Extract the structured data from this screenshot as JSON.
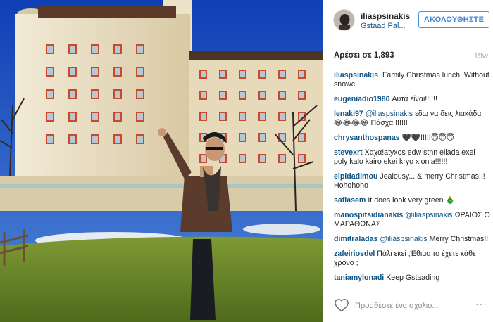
{
  "header": {
    "username": "iliaspsinakis",
    "location": "Gstaad Pal...",
    "follow_label": "ΑΚΟΛΟΥΘΗΣΤΕ"
  },
  "stats": {
    "likes_label": "Αρέσει σε 1,893",
    "time_ago": "19w"
  },
  "comments": [
    {
      "user": "iliaspsinakis",
      "text": " Family Christmas lunch  Without snowc"
    },
    {
      "user": "eugeniadio1980",
      "text": "Αυτά είναι!!!!!!"
    },
    {
      "user": "lenaki97",
      "mention": "@iliaspsinakis",
      "text": "εδω να δεις λιακάδα 😂😂😂😂 Πάσχα !!!!!!"
    },
    {
      "user": "chrysanthospanas",
      "text": "🖤🖤!!!!!😇😇😇"
    },
    {
      "user": "stevexrt",
      "text": "Χαχα!atyxos edw sthn ellada exei poly kalo kairo ekei kryo xionia!!!!!!"
    },
    {
      "user": "elpidadimou",
      "text": "Jealousy... & merry Christmas!!! Hohohoho"
    },
    {
      "user": "safiasem",
      "text": "It does look very green 🎄"
    },
    {
      "user": "manospitsidianakis",
      "mention": "@iliaspsinakis",
      "text": "ΩΡΑΙΟΣ Ο ΜΑΡΑΘΩΝΑΣ"
    },
    {
      "user": "dimitraladas",
      "mention": "@iliaspsinakis",
      "text": "Merry Christmas!!"
    },
    {
      "user": "zafeiriosdel",
      "text": "Πάλι εκεί ;Έθιμο το έχετε κάθε χρόνο ;"
    },
    {
      "user": "taniamylonadi",
      "text": "Keep Gstaading"
    }
  ],
  "footer": {
    "comment_placeholder": "Προσθέστε ένα σχόλιο...",
    "more_symbol": "···"
  },
  "colors": {
    "link_blue": "#125688",
    "follow_blue": "#3d86d6",
    "sky": "#1e4fb0",
    "hotel_wall": "#efe3c6",
    "shutters": "#c94a2a",
    "grass": "#6f8a2a"
  },
  "icons": {
    "heart": "heart-outline-icon",
    "more": "ellipsis-icon"
  }
}
